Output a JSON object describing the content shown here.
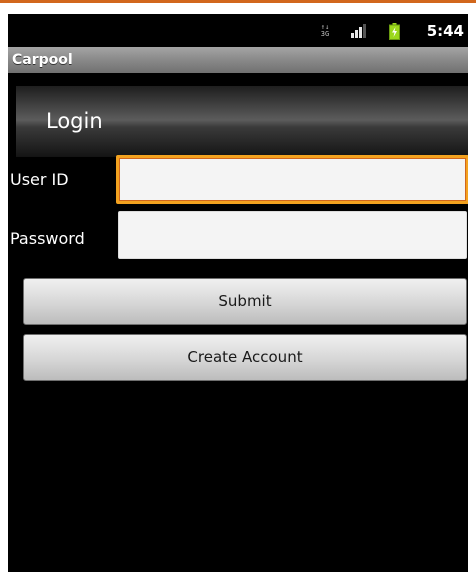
{
  "status_bar": {
    "network_type_top": "↑↓",
    "network_type_bottom": "3G",
    "signal_icon": "signal-bars-icon",
    "battery_icon": "battery-charging-icon",
    "time": "5:44",
    "accent_color": "#d2671c",
    "battery_color": "#9bd81c"
  },
  "app": {
    "title": "Carpool"
  },
  "login": {
    "heading": "Login"
  },
  "form": {
    "user_id_label": "User ID",
    "user_id_value": "",
    "password_label": "Password",
    "password_value": "",
    "focus_color": "#f3a21f"
  },
  "buttons": {
    "submit_label": "Submit",
    "create_account_label": "Create Account"
  }
}
